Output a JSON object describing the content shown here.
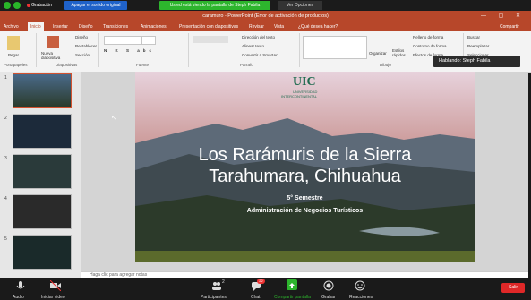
{
  "zoom": {
    "recording_label": "Grabación",
    "original_sound": "Apagar el sonido original",
    "share_banner": "Usted está viendo la pantalla de  Steph Fabila",
    "view_options": "Ver Opciones",
    "speaking": "Hablando: Steph Fabila",
    "toolbar": [
      "Audio",
      "Iniciar video",
      "Participantes",
      "Chat",
      "Compartir pantalla",
      "Grabar",
      "Reacciones"
    ],
    "participants_count": "2",
    "chat_badge": "22",
    "end_label": "Salir"
  },
  "ppt": {
    "title": "caramuro  -  PowerPoint (Error de activación de productos)",
    "tabs": [
      "Archivo",
      "Inicio",
      "Insertar",
      "Diseño",
      "Transiciones",
      "Animaciones",
      "Presentación con diapositivas",
      "Revisar",
      "Vista"
    ],
    "search": "¿Qué desea hacer?",
    "share": "Compartir",
    "ribbon": {
      "portapapeles": "Portapapeles",
      "diapositivas": "Diapositivas",
      "fuente": "Fuente",
      "parrafo": "Párrafo",
      "dibujo": "Dibujo",
      "pegar": "Pegar",
      "nueva": "Nueva diapositiva",
      "diseno": "Diseño",
      "restablecer": "Restablecer",
      "seccion": "Sección",
      "direccion": "Dirección del texto",
      "alinear": "Alinear texto",
      "convertir": "Convertir a SmartArt",
      "organizar": "Organizar",
      "estilos": "Estilos rápidos",
      "relleno": "Relleno de forma",
      "contorno": "Contorno de forma",
      "efectos": "Efectos de forma",
      "buscar": "Buscar",
      "reemplazar": "Reemplazar",
      "seleccionar": "Seleccionar"
    },
    "thumbnails": [
      "1",
      "2",
      "3",
      "4",
      "5"
    ],
    "notes_placeholder": "Haga clic para agregar notas",
    "slide": {
      "logo": "UIC",
      "university": "UNIVERSIDAD",
      "university2": "INTERCONTINENTAL",
      "title_line1": "Los Rarámuris de la Sierra",
      "title_line2": "Tarahumara, Chihuahua",
      "semester": "5° Semestre",
      "program": "Administración de Negocios Turísticos"
    }
  }
}
